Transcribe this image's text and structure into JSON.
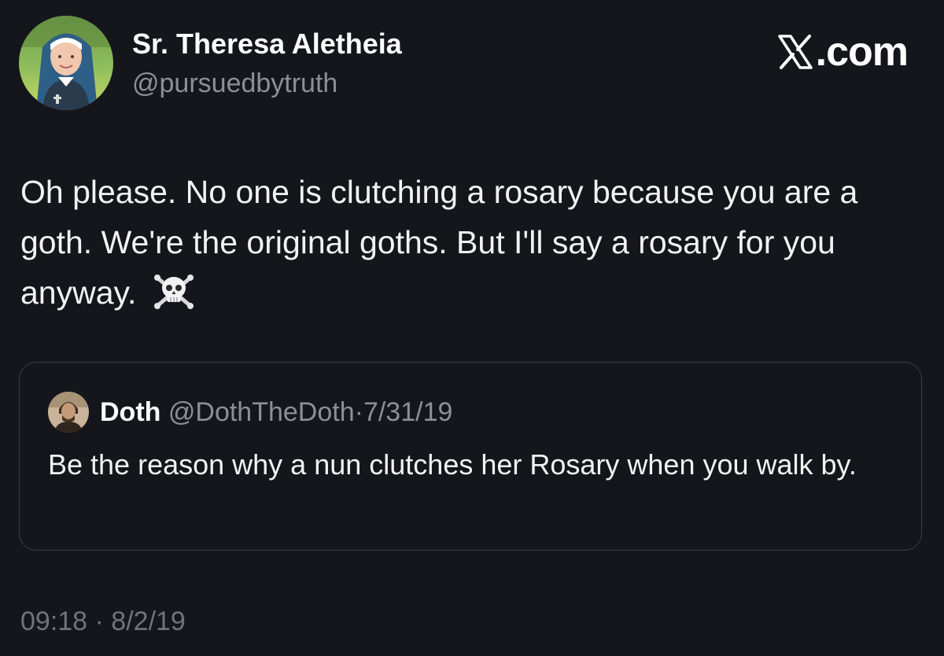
{
  "author": {
    "display_name": "Sr. Theresa Aletheia",
    "handle": "@pursuedbytruth"
  },
  "brand": {
    "icon": "x-logo-icon",
    "suffix": ".com"
  },
  "tweet": {
    "text": "Oh please. No one is clutching a rosary because you are a goth. We're the original goths. But I'll say a rosary for you anyway.",
    "emoji": "skull-and-crossbones-icon",
    "timestamp": "09:18 · 8/2/19"
  },
  "quoted_tweet": {
    "display_name": "Doth",
    "handle": "@DothTheDoth",
    "separator": "·",
    "date": "7/31/19",
    "text": "Be the reason why a nun clutches her Rosary when you walk by."
  },
  "colors": {
    "background": "#15161c",
    "text_primary": "#ffffff",
    "text_secondary": "#8b9096",
    "border": "#3a3d44"
  }
}
